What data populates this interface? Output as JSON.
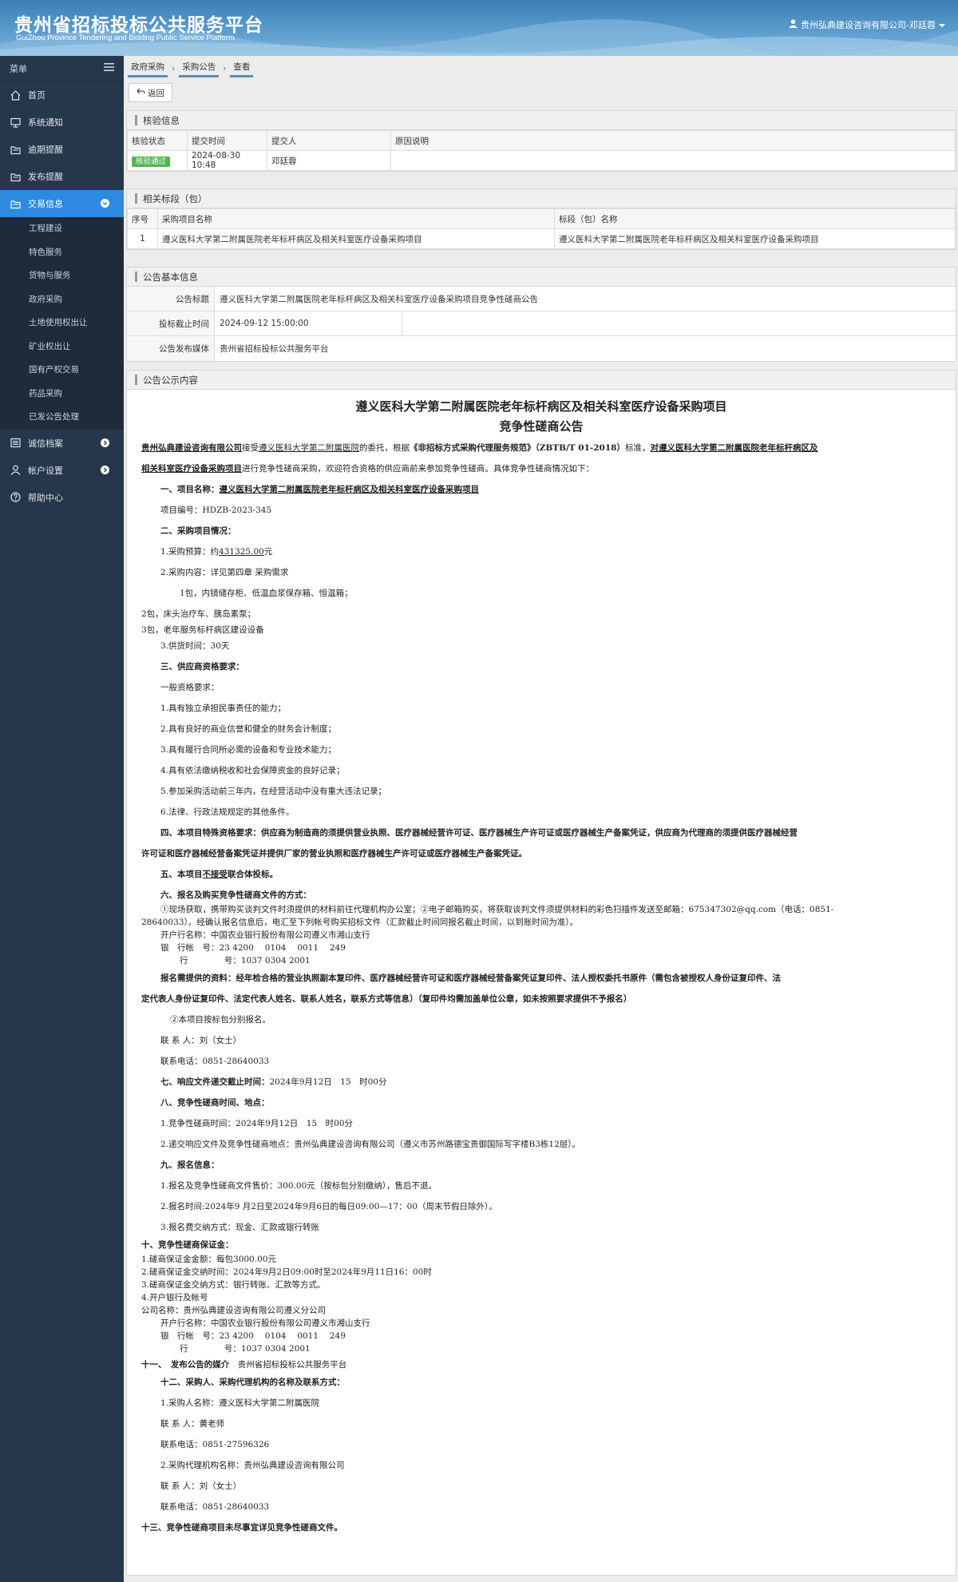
{
  "header": {
    "title": "贵州省招标投标公共服务平台",
    "subtitle": "GuiZhou Province Tendering and Bidding Public Service Platform",
    "user": "贵州弘典建设咨询有限公司-邓廷蓉"
  },
  "sidebar": {
    "menu_label": "菜单",
    "items": [
      {
        "label": "首页",
        "icon": "home-icon"
      },
      {
        "label": "系统通知",
        "icon": "monitor-icon"
      },
      {
        "label": "逾期提醒",
        "icon": "folder-icon"
      },
      {
        "label": "发布提醒",
        "icon": "folder-icon"
      },
      {
        "label": "交易信息",
        "icon": "folder-icon"
      },
      {
        "label": "诚信档案",
        "icon": "list-icon"
      },
      {
        "label": "帐户设置",
        "icon": "user-icon"
      },
      {
        "label": "帮助中心",
        "icon": "help-icon"
      }
    ],
    "sub_items": [
      "工程建设",
      "特色服务",
      "货物与服务",
      "政府采购",
      "土地使用权出让",
      "矿业权出让",
      "国有产权交易",
      "药品采购",
      "已发公告处理"
    ]
  },
  "breadcrumb": [
    "政府采购",
    "采购公告",
    "查看"
  ],
  "back_label": "返回",
  "check": {
    "title": "核验信息",
    "headers": [
      "核验状态",
      "提交时间",
      "提交人",
      "原因说明"
    ],
    "status": "核验通过",
    "time": "2024-08-30 10:48",
    "person": "邓廷蓉",
    "reason": ""
  },
  "sections": {
    "title": "相关标段（包）",
    "headers": [
      "序号",
      "采购项目名称",
      "标段（包）名称"
    ],
    "row": {
      "no": "1",
      "project": "遵义医科大学第二附属医院老年标杆病区及相关科室医疗设备采购项目",
      "section": "遵义医科大学第二附属医院老年标杆病区及相关科室医疗设备采购项目"
    }
  },
  "basic": {
    "title": "公告基本信息",
    "k1": "公告标题",
    "v1": "遵义医科大学第二附属医院老年标杆病区及相关科室医疗设备采购项目竞争性磋商公告",
    "k2": "投标截止时间",
    "v2": "2024-09-12 15:00:00",
    "k3": "公告发布媒体",
    "v3": "贵州省招标投标公共服务平台"
  },
  "notice": {
    "panel_title": "公告公示内容",
    "title1": "遵义医科大学第二附属医院老年标杆病区及相关科室医疗设备采购项目",
    "title2": "竞争性磋商公告",
    "p1_agency": "贵州弘典建设咨询有限公司",
    "p1_a": "接受",
    "p1_client": "遵义医科大学第二附属医院",
    "p1_b": "的委托，根据",
    "p1_std": "《非招标方式采购代理服务规范》（ZBTB/T 01-2018）",
    "p1_c": "标准，",
    "p1_proj1": "对遵义医科大学第二附属医院老年标杆病区及",
    "p1_proj2": "相关科室医疗设备采购项目",
    "p1_d": "进行竞争性磋商采购，欢迎符合资格的供应商前来参加竞争性磋商。具体竞争性磋商情况如下：",
    "s1_label": "一、项目名称：",
    "s1_name": "遵义医科大学第二附属医院老年标杆病区及相关科室医疗设备采购项目",
    "code": "项目编号：HDZB-2023-345",
    "s2": "二、采购项目情况：",
    "budget_a": "1.采购预算：约",
    "budget_v": "431325.00",
    "budget_b": "元",
    "content": "2.采购内容：详见第四章 采购需求",
    "pkg1": "1包，内镜储存柜、低温血浆保存箱、恒温箱；",
    "pkg2": "2包，床头治疗车、胰岛素泵；",
    "pkg3": "3包，老年服务标杆病区建设设备",
    "supply": "3.供货时间：30天",
    "s3": "三、供应商资格要求：",
    "general": "一般资格要求：",
    "q1": "1.具有独立承担民事责任的能力；",
    "q2": "2.具有良好的商业信誉和健全的财务会计制度；",
    "q3": "3.具有履行合同所必需的设备和专业技术能力；",
    "q4": "4.具有依法缴纳税收和社会保障资金的良好记录；",
    "q5": "5.参加采购活动前三年内，在经营活动中没有重大违法记录；",
    "q6": "6.法律、行政法规规定的其他条件。",
    "s4_a": "四、本项目特殊资格要求：供应商为制造商的须提供营业执照、医疗器械经营许可证、医疗器械生产许可证或医疗器械生产备案凭证，供应商为代理商的须提供医疗器械经营",
    "s4_b": "许可证和医疗器械经营备案凭证并提供厂家的营业执照和医疗器械生产许可证或医疗器械生产备案凭证。",
    "s5_a": "五、本项目",
    "s5_u": "不接受",
    "s5_b": "联合体投标。",
    "s6": "六、报名及购买竞争性磋商文件的方式：",
    "s6_a": "①现场获取，携带购买谈判文件时须提供的材料前往代理机构办公室；②电子邮箱购买，将获取谈判文件须提供材料的彩色扫描件发送至邮箱：675347302@qq.com（电话：0851-",
    "s6_b": "28640033）。经确认报名信息后，电汇至下列帐号购买招标文件（汇款截止时间同报名截止时间，以到账时间为准）。",
    "bank1": "开户行名称：中国农业银行股份有限公司遵义市湘山支行",
    "acct1": "银　行帐　号：23 4200　 0104　 0011　 249",
    "line1": "行　　　　 号：1037 0304 2001",
    "mat_a": "报名需提供的资料：经年检合格的营业执照副本复印件、医疗器械经营许可证和医疗器械经营备案凭证复印件、法人授权委托书原件（需包含被授权人身份证复印件、法",
    "mat_b": "定代表人身份证复印件、法定代表人姓名、联系人姓名，联系方式等信息）（复印件均需加盖单位公章，如未按照要求提供不予报名）",
    "pkg_reg": "②本项目按标包分别报名。",
    "contact1": "联 系 人：刘（女士）",
    "phone1": "联系电话：0851-28640033",
    "s7_a": "七、响应文件递交截止时间：",
    "s7_b": "2024年9月12日　15　时00分",
    "s8": "八、竞争性磋商时间、地点：",
    "t8_1": "1.竞争性磋商时间：2024年9月12日　15　时00分",
    "t8_2": "2.递交响应文件及竞争性磋商地点：贵州弘典建设咨询有限公司（遵义市苏州路德宝贵御国际写字楼B3栋12层）。",
    "s9": "九、报名信息：",
    "t9_1": "1.报名及竞争性磋商文件售价：300.00元（按标包分别缴纳），售后不退。",
    "t9_2": "2.报名时间:2024年9 月2日至2024年9月6日的每日09:00—17：00（周末节假日除外）。",
    "t9_3": "3.报名费交纳方式：现金、汇款或银行转账",
    "s10": "十、竞争性磋商保证金：",
    "t10_1": "1.磋商保证金金额：每包3000.00元",
    "t10_2": "2.磋商保证金交纳时间：2024年9月2日09:00时至2024年9月11日16：00时",
    "t10_3": "3.磋商保证金交纳方式：银行转账、汇款等方式。",
    "t10_4": "4.开户银行及帐号",
    "company": "公司名称：贵州弘典建设咨询有限公司遵义分公司",
    "bank2": "开户行名称：中国农业银行股份有限公司遵义市湘山支行",
    "acct2": "银　行帐　号：23 4200　 0104　 0011　 249",
    "line2": "行　　　　 号：1037 0304 2001",
    "s11_a": "十一、　发布公告的媒介",
    "s11_b": "贵州省招标投标公共服务平台",
    "s12": "十二、采购人、采购代理机构的名称及联系方式：",
    "t12_1": "1.采购人名称：遵义医科大学第二附属医院",
    "t12_c1": "联 系 人：黄老师",
    "t12_p1": "联系电话：0851-27596326",
    "t12_2": "2.采购代理机构名称：贵州弘典建设咨询有限公司",
    "t12_c2": "联 系 人：刘（女士）",
    "t12_p2": "联系电话：0851-28640033",
    "s13": "十三、竞争性磋商项目未尽事宜详见竞争性磋商文件。"
  }
}
